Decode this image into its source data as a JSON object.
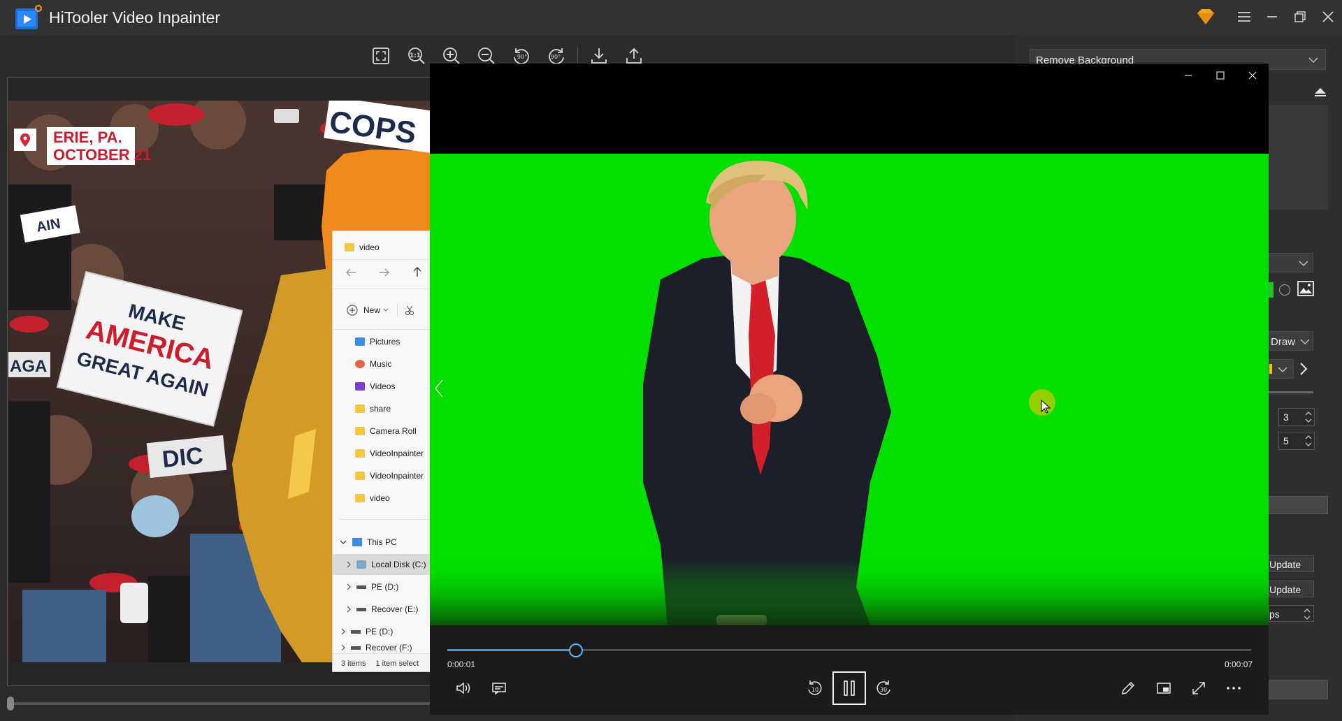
{
  "app": {
    "title": "HiTooler Video Inpainter",
    "icons": [
      "app-logo-icon",
      "premium-diamond-icon",
      "menu-icon",
      "minimize-icon",
      "restore-icon",
      "close-icon"
    ]
  },
  "toolbar": {
    "tools": [
      "fit-screen-icon",
      "actual-size-icon",
      "zoom-in-icon",
      "zoom-out-icon",
      "rotate-left-90-icon",
      "rotate-right-90-icon",
      "download-icon",
      "share-icon"
    ],
    "rotate_label": "90°"
  },
  "canvas": {
    "location_line1": "ERIE, PA.",
    "location_line2": "OCTOBER 21",
    "sign_line1": "MAKE",
    "sign_line2": "AMERICA",
    "sign_line3": "GREAT AGAIN",
    "sign_bg_text1": "COPS",
    "sign_bg_text2": "AIN",
    "sign_bg_text3": "AGA",
    "sign_bg_text4": "DIC"
  },
  "right_panel": {
    "mode_select": "Remove Background",
    "draw_select": "Draw",
    "spin1": "3",
    "spin2": "5",
    "update1": "Update",
    "update2": "Update",
    "fps_label": "ps"
  },
  "explorer": {
    "title": "video",
    "new_label": "New",
    "quick_items": [
      "Pictures",
      "Music",
      "Videos",
      "share",
      "Camera Roll",
      "VideoInpainter",
      "VideoInpainter",
      "video"
    ],
    "this_pc": "This PC",
    "drives": [
      "Local Disk (C:)",
      "PE (D:)",
      "Recover (E:)"
    ],
    "extra_drives": [
      "PE (D:)",
      "Recover (F:)"
    ],
    "status_items": "3 items",
    "status_selected": "1 item select"
  },
  "player": {
    "time_current": "0:00:01",
    "time_total": "0:00:07",
    "progress": 0.16,
    "skip_back": "10",
    "skip_forward": "30",
    "colors": {
      "green_screen": "#00df00",
      "accent": "#2f9cf2"
    }
  }
}
